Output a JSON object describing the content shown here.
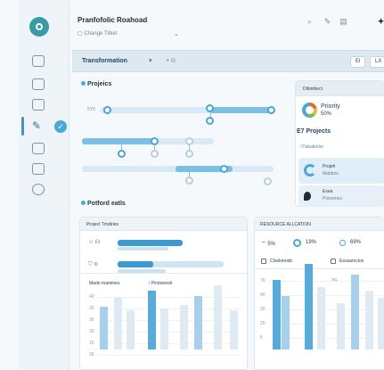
{
  "header": {
    "title": "Pranfofolic Roahoad",
    "subtitle": "Change Titkel",
    "icons": [
      "search-icon",
      "edit-icon",
      "document-icon",
      "sparkle-icon"
    ]
  },
  "toolbar": {
    "title": "Transformation",
    "button1": "El",
    "button2": "LX"
  },
  "projects": {
    "title": "Projeics",
    "label": "5Y5"
  },
  "right_panel": {
    "header": "Dibinibect",
    "priority_label": "Priority",
    "priority_value": "50%",
    "projects_title": "Projects",
    "projects_prefix": "E7",
    "sub_label": "Pabalenlor",
    "card1_title": "Projeh",
    "card1_sub": "Mabbos",
    "card2_title": "Exea",
    "card2_sub": "Poisomes"
  },
  "portfolio": {
    "title": "Potford eatls"
  },
  "project_timeline": {
    "title": "Project Tmdiries",
    "chart_left": "Mado rnamines",
    "chart_right": "Pirstonesh",
    "yticks": [
      "40",
      "30",
      "36",
      "30",
      "15",
      "20"
    ]
  },
  "resource": {
    "title": "RESOURCE ALLCATION",
    "stat1": "5%",
    "stat2": "19%",
    "stat3": "69%",
    "check1": "Clookmods",
    "check2": "Esosaroclos",
    "yticks": [
      "70",
      "40",
      "30",
      "20",
      "5"
    ],
    "top_label": "3G"
  },
  "colors": {
    "accent": "#4aa8d6",
    "accent_dark": "#3d6f94",
    "bar_light": "#a8d0ea"
  }
}
